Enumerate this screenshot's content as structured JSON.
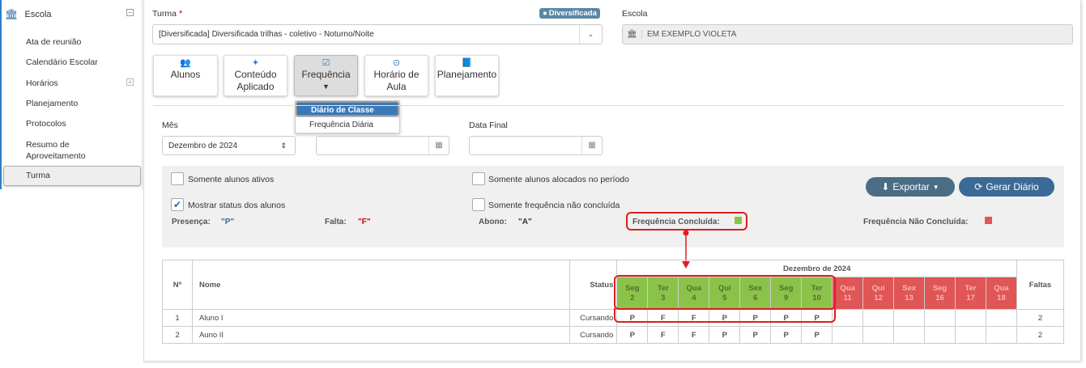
{
  "sidebar": {
    "title": "Escola",
    "items": [
      "Ata de reunião",
      "Calendário Escolar",
      "Horários",
      "Planejamento",
      "Protocolos",
      "Resumo de Aproveitamento",
      "Turma"
    ]
  },
  "turma": {
    "label": "Turma",
    "required": "*",
    "badge": "Diversificada",
    "value": "[Diversificada]  Diversificada trilhas - coletivo - Noturno/Noite"
  },
  "escola": {
    "label": "Escola",
    "value": "EM EXEMPLO VIOLETA"
  },
  "tabs": [
    {
      "label1": "Alunos",
      "label2": "",
      "icon": "users-icon"
    },
    {
      "label1": "Conteúdo",
      "label2": "Aplicado",
      "icon": "magic-wand-icon"
    },
    {
      "label1": "Frequência",
      "label2": "",
      "icon": "checkbox-icon"
    },
    {
      "label1": "Horário de",
      "label2": "Aula",
      "icon": "clock-icon"
    },
    {
      "label1": "Planejamento",
      "label2": "",
      "icon": "book-icon"
    }
  ],
  "freq_menu": [
    "Diário de Classe",
    "Frequência Diária"
  ],
  "filters": {
    "mes_label": "Mês",
    "mes_value": "Dezembro de 2024",
    "data_final_label": "Data Final",
    "cb1": "Somente alunos ativos",
    "cb2": "Somente alunos alocados no período",
    "cb3": "Mostrar status dos alunos",
    "cb4": "Somente frequência não concluída"
  },
  "legend": {
    "presenca": "Presença:",
    "presenca_val": "\"P\"",
    "falta": "Falta:",
    "falta_val": "\"F\"",
    "abono": "Abono:",
    "abono_val": "\"A\"",
    "concluida": "Frequência Concluída:",
    "nao_concluida": "Frequência Não Concluída:"
  },
  "buttons": {
    "exportar": "Exportar",
    "gerar": "Gerar Diário"
  },
  "table": {
    "h_num": "Nº",
    "h_nome": "Nome",
    "h_status": "Status",
    "h_month": "Dezembro de 2024",
    "h_faltas": "Faltas",
    "days": [
      {
        "w": "Seg",
        "d": "2",
        "done": true
      },
      {
        "w": "Ter",
        "d": "3",
        "done": true
      },
      {
        "w": "Qua",
        "d": "4",
        "done": true
      },
      {
        "w": "Qui",
        "d": "5",
        "done": true
      },
      {
        "w": "Sex",
        "d": "6",
        "done": true
      },
      {
        "w": "Seg",
        "d": "9",
        "done": true
      },
      {
        "w": "Ter",
        "d": "10",
        "done": true
      },
      {
        "w": "Qua",
        "d": "11",
        "done": false
      },
      {
        "w": "Qui",
        "d": "12",
        "done": false
      },
      {
        "w": "Sex",
        "d": "13",
        "done": false
      },
      {
        "w": "Seg",
        "d": "16",
        "done": false
      },
      {
        "w": "Ter",
        "d": "17",
        "done": false
      },
      {
        "w": "Qua",
        "d": "18",
        "done": false
      }
    ],
    "rows": [
      {
        "num": "1",
        "nome": "Aluno I",
        "status": "Cursando",
        "marks": [
          "P",
          "F",
          "F",
          "P",
          "P",
          "P",
          "P",
          "",
          "",
          "",
          "",
          "",
          ""
        ],
        "faltas": "2"
      },
      {
        "num": "2",
        "nome": "Auno II",
        "status": "Cursando",
        "marks": [
          "P",
          "F",
          "F",
          "P",
          "P",
          "P",
          "P",
          "",
          "",
          "",
          "",
          "",
          ""
        ],
        "faltas": "2"
      }
    ]
  }
}
